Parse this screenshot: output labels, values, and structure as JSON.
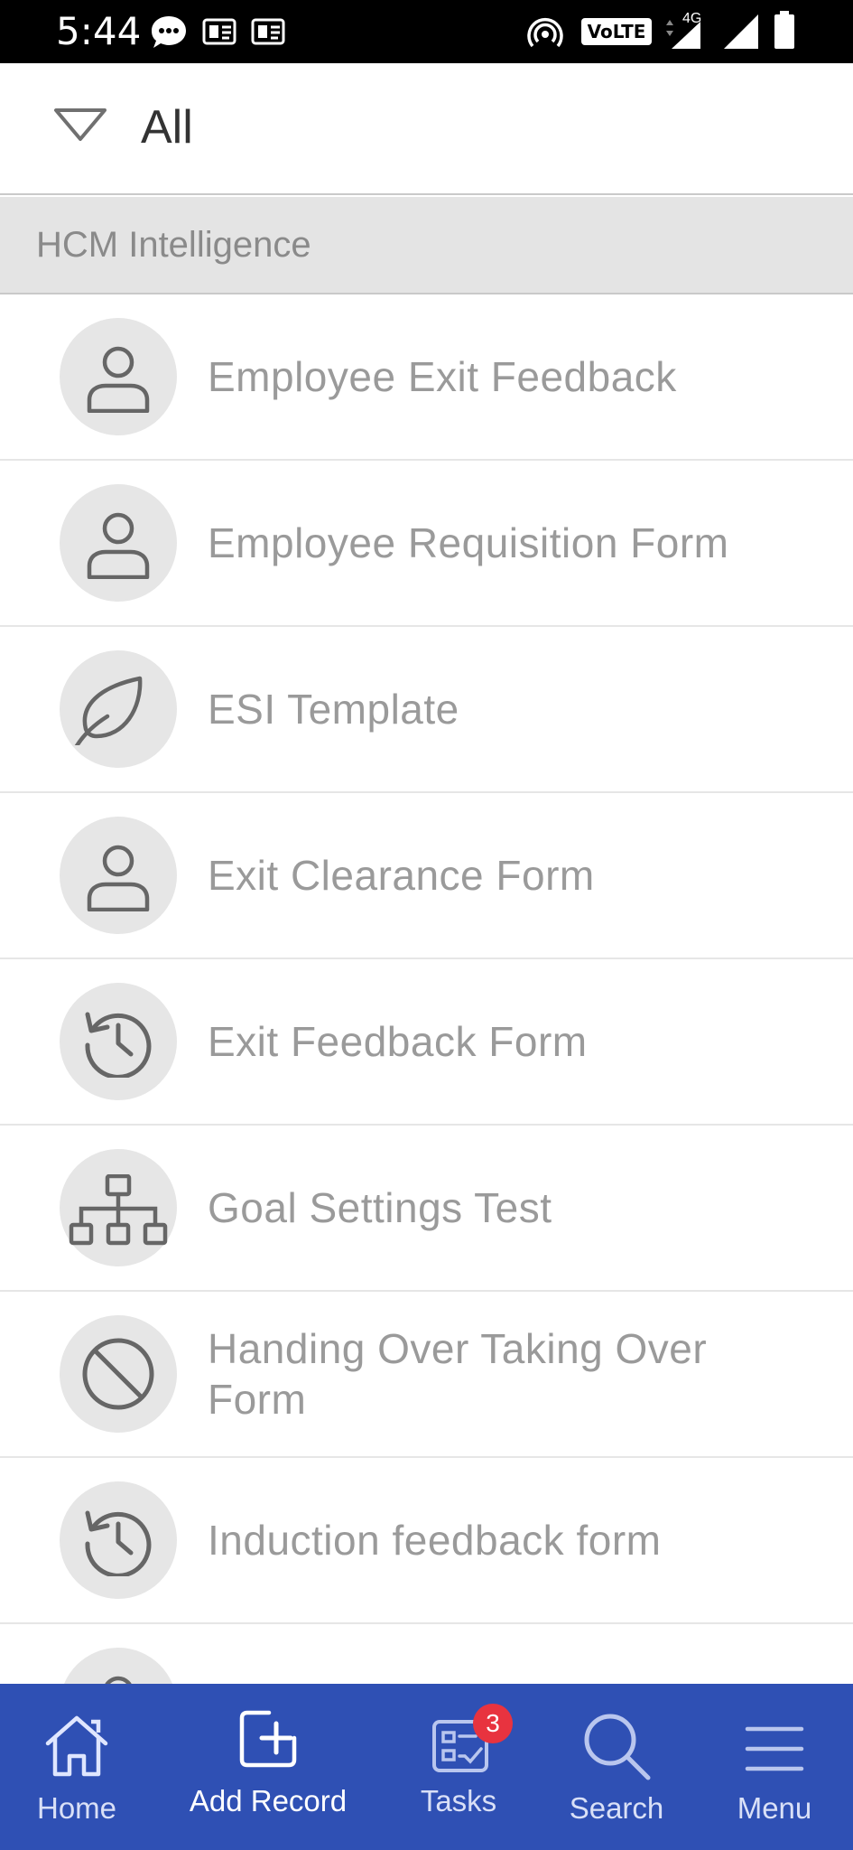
{
  "status_bar": {
    "time": "5:44",
    "icons": [
      "chat-bubble-icon",
      "notification-icon",
      "notification-icon",
      "hotspot-icon",
      "volte-icon",
      "signal-4g-icon",
      "signal-icon",
      "battery-icon"
    ],
    "volte_label": "VoLTE",
    "network_label": "4G"
  },
  "filter": {
    "label": "All"
  },
  "section": {
    "title": "HCM Intelligence"
  },
  "forms": [
    {
      "label": "Employee Exit Feedback",
      "icon": "person-icon"
    },
    {
      "label": "Employee Requisition Form",
      "icon": "person-icon"
    },
    {
      "label": "ESI Template",
      "icon": "leaf-icon"
    },
    {
      "label": "Exit Clearance Form",
      "icon": "person-icon"
    },
    {
      "label": "Exit Feedback Form",
      "icon": "history-icon"
    },
    {
      "label": "Goal Settings Test",
      "icon": "org-chart-icon"
    },
    {
      "label": "Handing Over Taking Over Form",
      "icon": "block-icon"
    },
    {
      "label": "Induction feedback form",
      "icon": "history-icon"
    },
    {
      "label": "",
      "icon": "person-icon"
    }
  ],
  "nav": {
    "home": "Home",
    "add_record": "Add Record",
    "tasks": "Tasks",
    "tasks_badge": "3",
    "search": "Search",
    "menu": "Menu"
  },
  "colors": {
    "nav_background": "#2f50b4",
    "badge": "#e8333f",
    "section_background": "#e4e4e4",
    "item_text": "#9a9a9a",
    "icon_circle": "#e6e6e6"
  }
}
